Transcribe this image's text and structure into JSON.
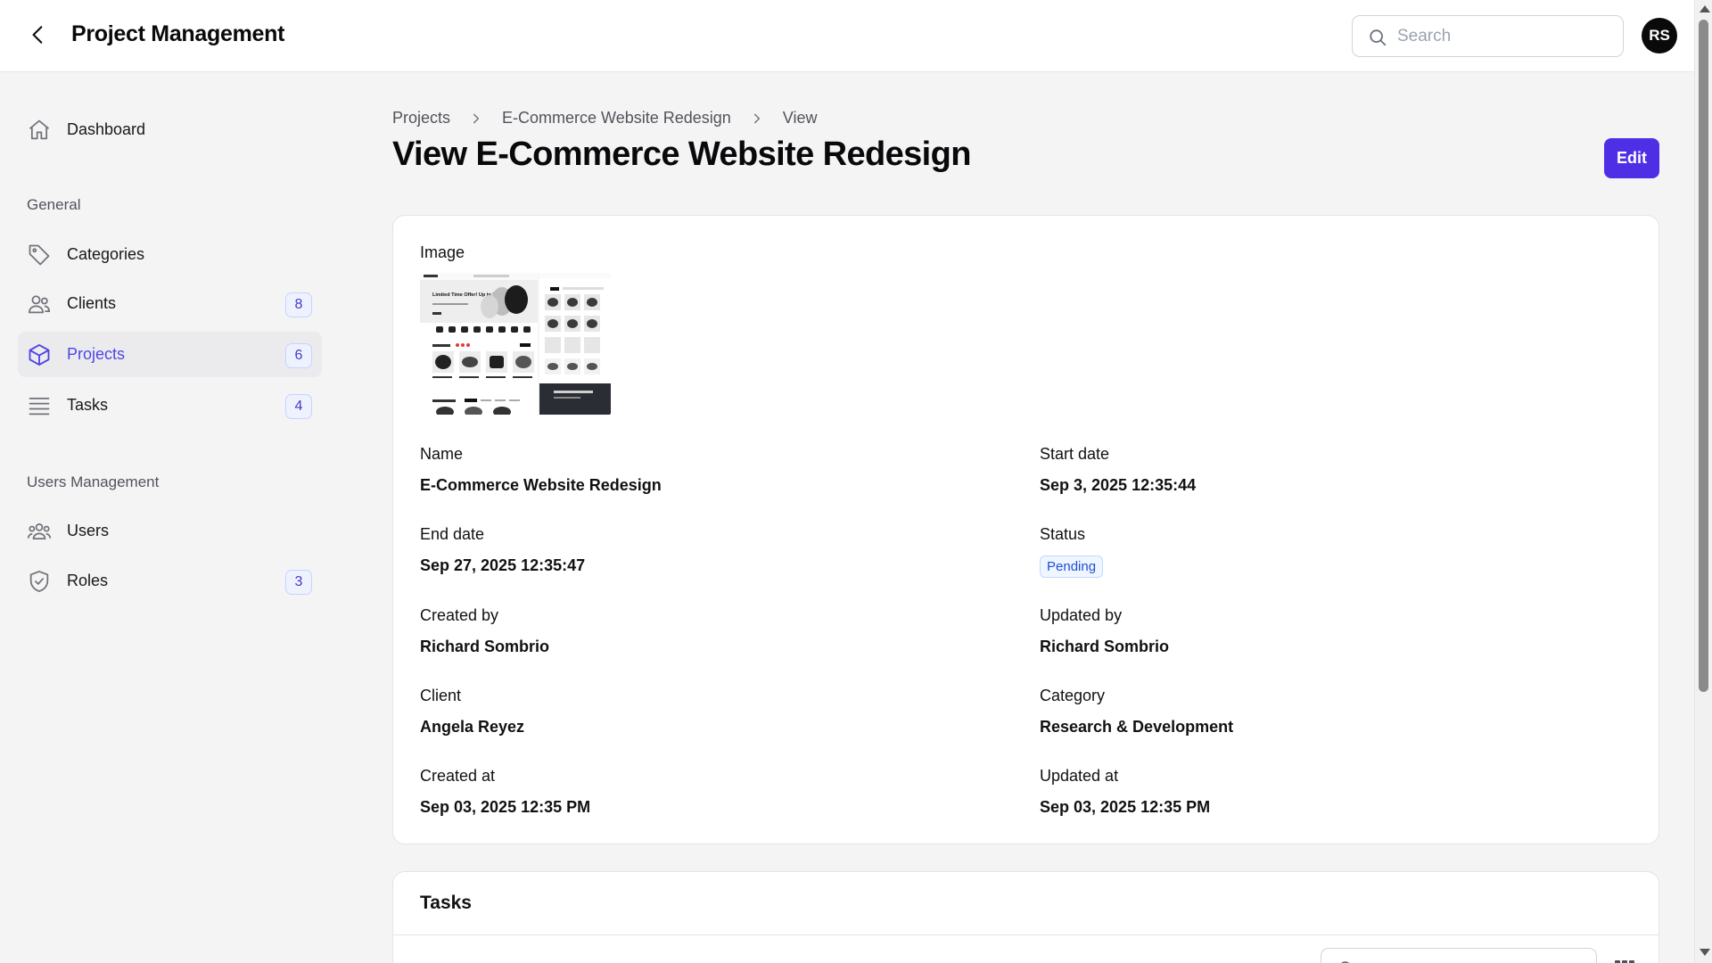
{
  "header": {
    "title": "Project Management",
    "search_placeholder": "Search",
    "avatar_initials": "RS"
  },
  "sidebar": {
    "dashboard": {
      "label": "Dashboard",
      "icon": "home-icon"
    },
    "groups": [
      {
        "label": "General"
      },
      {
        "label": "Users Management"
      }
    ],
    "items": [
      {
        "label": "Categories",
        "icon": "tag-icon",
        "badge": ""
      },
      {
        "label": "Clients",
        "icon": "users-icon",
        "badge": "8"
      },
      {
        "label": "Projects",
        "icon": "cube-icon",
        "badge": "6",
        "active": true
      },
      {
        "label": "Tasks",
        "icon": "list-icon",
        "badge": "4"
      },
      {
        "label": "Users",
        "icon": "user-group-icon",
        "badge": ""
      },
      {
        "label": "Roles",
        "icon": "shield-check-icon",
        "badge": "3"
      }
    ]
  },
  "breadcrumb": [
    "Projects",
    "E-Commerce Website Redesign",
    "View"
  ],
  "page": {
    "title": "View E-Commerce Website Redesign",
    "edit_label": "Edit"
  },
  "details": {
    "image_label": "Image",
    "image_title_text": "Limited Time Offer! Up to 50% OFF!",
    "name_label": "Name",
    "name_value": "E-Commerce Website Redesign",
    "start_label": "Start date",
    "start_value": "Sep 3, 2025 12:35:44",
    "end_label": "End date",
    "end_value": "Sep 27, 2025 12:35:47",
    "status_label": "Status",
    "status_value": "Pending",
    "created_by_label": "Created by",
    "created_by_value": "Richard Sombrio",
    "updated_by_label": "Updated by",
    "updated_by_value": "Richard Sombrio",
    "client_label": "Client",
    "client_value": "Angela Reyez",
    "category_label": "Category",
    "category_value": "Research & Development",
    "created_at_label": "Created at",
    "created_at_value": "Sep 03, 2025 12:35 PM",
    "updated_at_label": "Updated at",
    "updated_at_value": "Sep 03, 2025 12:35 PM"
  },
  "tasks_section": {
    "title": "Tasks"
  },
  "colors": {
    "accent": "#4f2fe6",
    "active_nav_text": "#4f46e5",
    "status_pending": "#1d4ed8"
  }
}
